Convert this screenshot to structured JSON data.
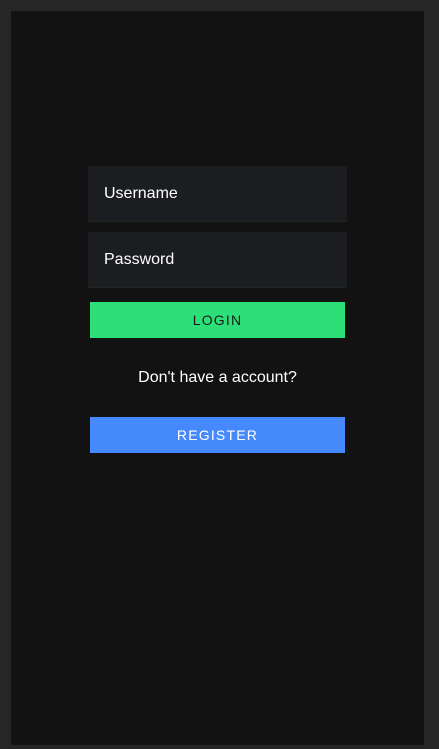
{
  "login_form": {
    "username_placeholder": "Username",
    "password_placeholder": "Password",
    "login_label": "LOGIN",
    "no_account_prompt": "Don't have a account?",
    "register_label": "REGISTER"
  },
  "colors": {
    "background": "#121212",
    "frame": "#262626",
    "field_background": "#1b1d21",
    "login_button": "#2ddf78",
    "register_button": "#4689fc"
  }
}
